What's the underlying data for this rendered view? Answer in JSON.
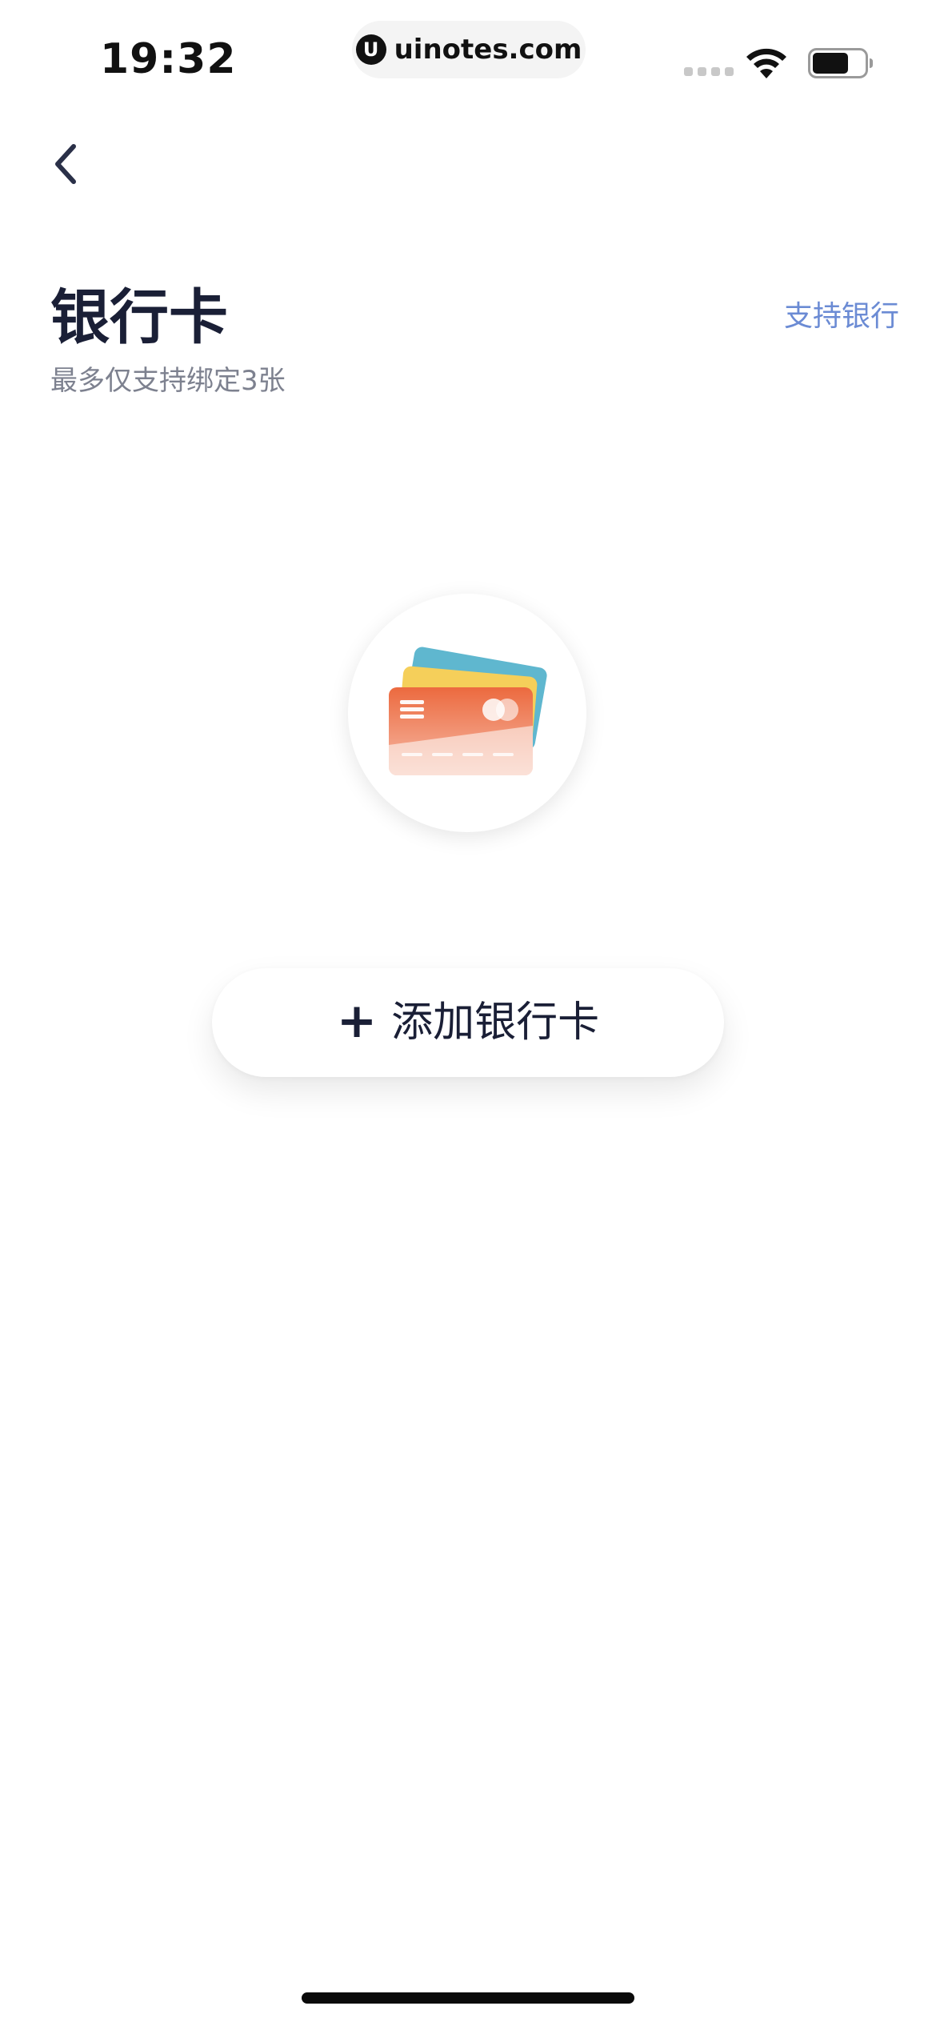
{
  "status_bar": {
    "time": "19:32",
    "url": "uinotes.com",
    "url_logo_glyph": "U"
  },
  "nav": {
    "back_icon": "chevron-left-icon"
  },
  "header": {
    "title": "银行卡",
    "subtitle": "最多仅支持绑定3张",
    "supported_banks_link": "支持银行"
  },
  "empty_state": {
    "illustration": "bank-cards-icon"
  },
  "actions": {
    "add_card_plus": "+",
    "add_card_label": "添加银行卡"
  },
  "colors": {
    "title": "#1a1f36",
    "subtitle": "#7d818f",
    "link": "#6b8bd4",
    "card_front": "#ec6a3f",
    "card_middle": "#f5cf5a",
    "card_back": "#5fb7cf"
  }
}
